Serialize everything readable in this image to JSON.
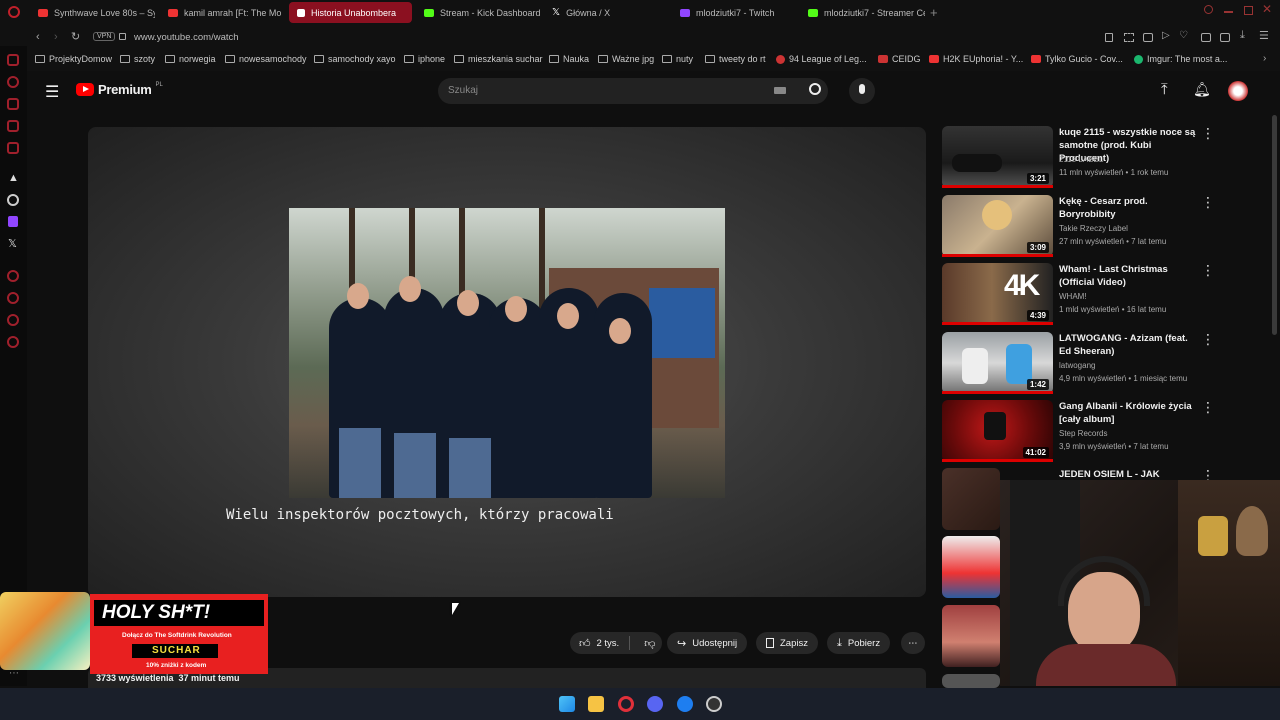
{
  "browser": {
    "tabs": [
      {
        "title": "Synthwave Love 80s – Sy",
        "color": "#e33"
      },
      {
        "title": "kamil amrah [Ft: The Mo",
        "color": "#e33"
      },
      {
        "title": "Historia Unabombera",
        "color": "#e33",
        "active": true
      },
      {
        "title": "Stream - Kick Dashboard",
        "color": "#53fc18"
      },
      {
        "title": "Główna / X",
        "color": "#fff"
      },
      {
        "title": "mlodziutki7 - Twitch",
        "color": "#9146ff"
      },
      {
        "title": "mlodziutki7 - Streamer Ce",
        "color": "#53fc18"
      }
    ],
    "url": "www.youtube.com/watch",
    "vpn_label": "VPN",
    "bookmarks": [
      "ProjektyDomow",
      "szoty",
      "norwegia",
      "nowesamochody",
      "samochody xayo",
      "iphone",
      "mieszkania suchar",
      "Nauka",
      "Ważne jpg",
      "nuty",
      "tweety do rt",
      "94 League of Leg...",
      "CEIDG",
      "H2K EUphoria! - Y...",
      "Tylko Gucio - Cov...",
      "Imgur: The most a..."
    ]
  },
  "youtube": {
    "logo_text": "Premium",
    "logo_suffix": "PL",
    "search_placeholder": "Szukaj",
    "accent": "#ff0000",
    "video": {
      "subtitle": "Wielu inspektorów pocztowych, którzy pracowali",
      "views_line": "3733 wyświetlenia  37 minut temu",
      "like_count": "2 tys.",
      "share_label": "Udostępnij",
      "save_label": "Zapisz",
      "download_label": "Pobierz"
    },
    "recommended": [
      {
        "title": "kuqe 2115 - wszystkie noce są samotne (prod. Kubi Producent)",
        "channel": "2115 LABEL",
        "meta": "11 mln wyświetleń • 1 rok temu",
        "duration": "3:21"
      },
      {
        "title": "Kękę  - Cesarz prod. Boryrobibity",
        "channel": "Takie Rzeczy Label",
        "meta": "27 mln wyświetleń • 7 lat temu",
        "duration": "3:09"
      },
      {
        "title": "Wham! - Last Christmas (Official Video)",
        "channel": "WHAM!",
        "meta": "1 mld wyświetleń • 16 lat temu",
        "duration": "4:39"
      },
      {
        "title": "LATWOGANG - Azizam (feat. Ed Sheeran)",
        "channel": "latwogang",
        "meta": "4,9 mln wyświetleń • 1 miesiąc temu",
        "duration": "1:42"
      },
      {
        "title": "Gang Albanii - Królowie życia [cały album]",
        "channel": "Step Records",
        "meta": "3,9 mln wyświetleń • 7 lat temu",
        "duration": "41:02"
      },
      {
        "title": "JEDEN OSIEM L - JAK",
        "channel": "",
        "meta": "",
        "duration": ""
      }
    ]
  },
  "ad": {
    "headline": "HOLY SH*T!",
    "line1": "Dołącz do The Softdrink Revolution",
    "brand": "SUCHAR",
    "line2": "10% zniżki z kodem"
  }
}
